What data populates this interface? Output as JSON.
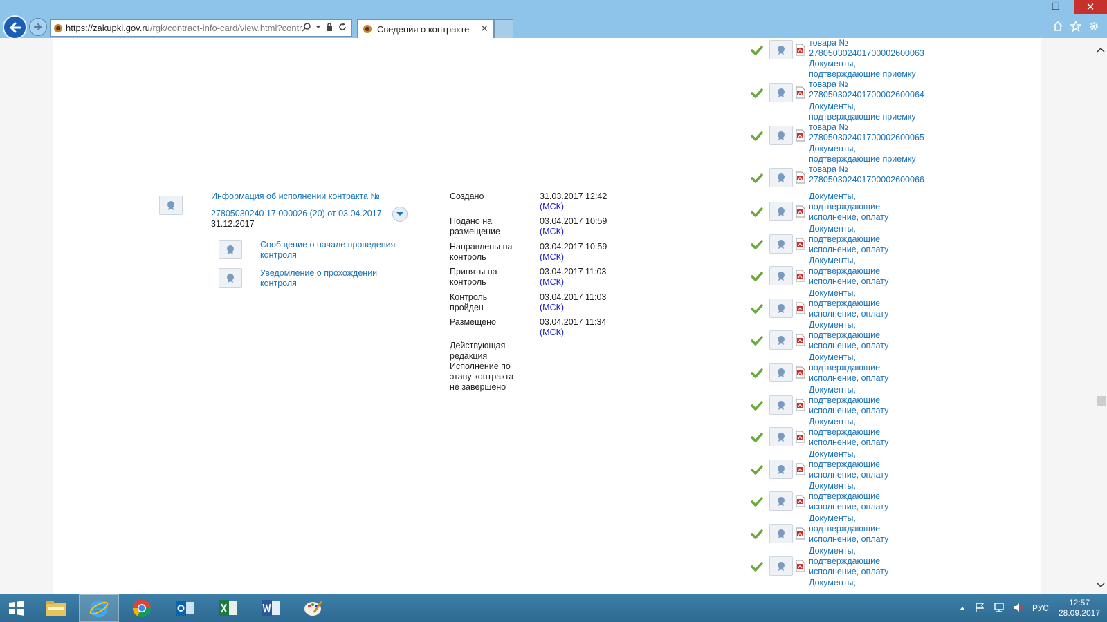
{
  "browser": {
    "url_main": "https://zakupki.gov.ru",
    "url_rest": "/rgk/contract-info-card/view.html?contrac",
    "tab_title": "Сведения о контракте",
    "tab_close": "✕",
    "minimize": "–",
    "maximize": "❐",
    "close": "✕"
  },
  "contract": {
    "title_line1": "Информация об исполнении контракта №",
    "title_line2": "27805030240 17 000026 (20) от 03.04.2017",
    "date": "31.12.2017",
    "sub_docs": [
      {
        "label": "Сообщение о начале проведения контроля"
      },
      {
        "label": "Уведомление о прохождении контроля"
      }
    ]
  },
  "statuses": [
    {
      "label": "Создано",
      "value": "31.03.2017 12:42",
      "tz": "(МСК)"
    },
    {
      "label": "Подано на размещение",
      "value": "03.04.2017 10:59",
      "tz": "(МСК)"
    },
    {
      "label": "Направлены на контроль",
      "value": "03.04.2017 10:59",
      "tz": "(МСК)"
    },
    {
      "label": "Приняты на контроль",
      "value": "03.04.2017 11:03",
      "tz": "(МСК)"
    },
    {
      "label": "Контроль пройден",
      "value": "03.04.2017 11:03",
      "tz": "(МСК)"
    },
    {
      "label": "Размещено",
      "value": "03.04.2017 11:34",
      "tz": "(МСК)"
    }
  ],
  "edition_note": "Действующая редакция Исполнение по этапу контракта не завершено",
  "top_docs": [
    {
      "lines": [
        "товара №",
        "278050302401700002600063"
      ]
    },
    {
      "lines": [
        "Документы,",
        "подтверждающие приемку",
        "товара №",
        "278050302401700002600064"
      ]
    },
    {
      "lines": [
        "Документы,",
        "подтверждающие приемку",
        "товара №",
        "278050302401700002600065"
      ]
    },
    {
      "lines": [
        "Документы,",
        "подтверждающие приемку",
        "товара №",
        "278050302401700002600066"
      ]
    }
  ],
  "payment_doc": {
    "line1": "Документы,",
    "line2": "подтверждающие",
    "line3": "исполнение, оплату"
  },
  "payment_doc_count": 12,
  "last_partial": "Документы,",
  "taskbar": {
    "lang": "РУС",
    "time": "12:57",
    "date": "28.09.2017"
  }
}
